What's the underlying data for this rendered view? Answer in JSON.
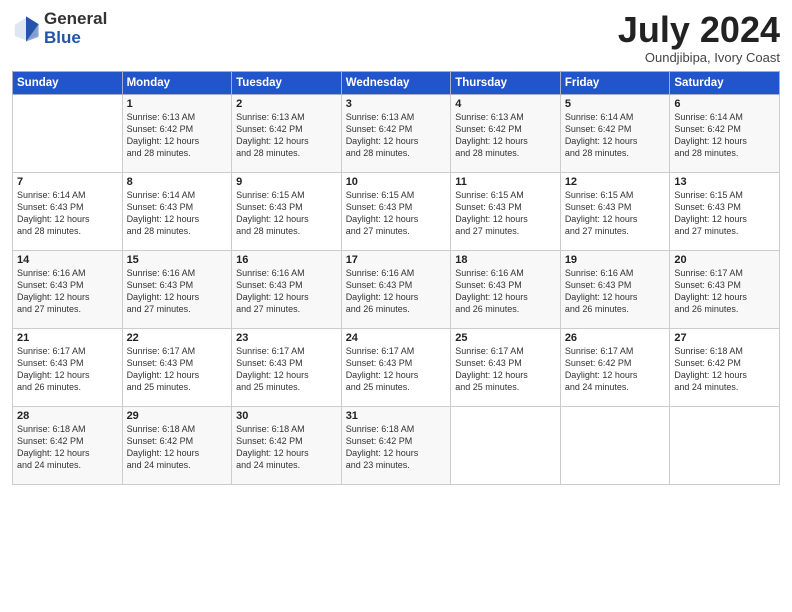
{
  "header": {
    "logo_general": "General",
    "logo_blue": "Blue",
    "month_title": "July 2024",
    "subtitle": "Oundjibipa, Ivory Coast"
  },
  "days_of_week": [
    "Sunday",
    "Monday",
    "Tuesday",
    "Wednesday",
    "Thursday",
    "Friday",
    "Saturday"
  ],
  "weeks": [
    [
      {
        "day": "",
        "info": ""
      },
      {
        "day": "1",
        "info": "Sunrise: 6:13 AM\nSunset: 6:42 PM\nDaylight: 12 hours\nand 28 minutes."
      },
      {
        "day": "2",
        "info": "Sunrise: 6:13 AM\nSunset: 6:42 PM\nDaylight: 12 hours\nand 28 minutes."
      },
      {
        "day": "3",
        "info": "Sunrise: 6:13 AM\nSunset: 6:42 PM\nDaylight: 12 hours\nand 28 minutes."
      },
      {
        "day": "4",
        "info": "Sunrise: 6:13 AM\nSunset: 6:42 PM\nDaylight: 12 hours\nand 28 minutes."
      },
      {
        "day": "5",
        "info": "Sunrise: 6:14 AM\nSunset: 6:42 PM\nDaylight: 12 hours\nand 28 minutes."
      },
      {
        "day": "6",
        "info": "Sunrise: 6:14 AM\nSunset: 6:42 PM\nDaylight: 12 hours\nand 28 minutes."
      }
    ],
    [
      {
        "day": "7",
        "info": "Sunrise: 6:14 AM\nSunset: 6:43 PM\nDaylight: 12 hours\nand 28 minutes."
      },
      {
        "day": "8",
        "info": "Sunrise: 6:14 AM\nSunset: 6:43 PM\nDaylight: 12 hours\nand 28 minutes."
      },
      {
        "day": "9",
        "info": "Sunrise: 6:15 AM\nSunset: 6:43 PM\nDaylight: 12 hours\nand 28 minutes."
      },
      {
        "day": "10",
        "info": "Sunrise: 6:15 AM\nSunset: 6:43 PM\nDaylight: 12 hours\nand 27 minutes."
      },
      {
        "day": "11",
        "info": "Sunrise: 6:15 AM\nSunset: 6:43 PM\nDaylight: 12 hours\nand 27 minutes."
      },
      {
        "day": "12",
        "info": "Sunrise: 6:15 AM\nSunset: 6:43 PM\nDaylight: 12 hours\nand 27 minutes."
      },
      {
        "day": "13",
        "info": "Sunrise: 6:15 AM\nSunset: 6:43 PM\nDaylight: 12 hours\nand 27 minutes."
      }
    ],
    [
      {
        "day": "14",
        "info": "Sunrise: 6:16 AM\nSunset: 6:43 PM\nDaylight: 12 hours\nand 27 minutes."
      },
      {
        "day": "15",
        "info": "Sunrise: 6:16 AM\nSunset: 6:43 PM\nDaylight: 12 hours\nand 27 minutes."
      },
      {
        "day": "16",
        "info": "Sunrise: 6:16 AM\nSunset: 6:43 PM\nDaylight: 12 hours\nand 27 minutes."
      },
      {
        "day": "17",
        "info": "Sunrise: 6:16 AM\nSunset: 6:43 PM\nDaylight: 12 hours\nand 26 minutes."
      },
      {
        "day": "18",
        "info": "Sunrise: 6:16 AM\nSunset: 6:43 PM\nDaylight: 12 hours\nand 26 minutes."
      },
      {
        "day": "19",
        "info": "Sunrise: 6:16 AM\nSunset: 6:43 PM\nDaylight: 12 hours\nand 26 minutes."
      },
      {
        "day": "20",
        "info": "Sunrise: 6:17 AM\nSunset: 6:43 PM\nDaylight: 12 hours\nand 26 minutes."
      }
    ],
    [
      {
        "day": "21",
        "info": "Sunrise: 6:17 AM\nSunset: 6:43 PM\nDaylight: 12 hours\nand 26 minutes."
      },
      {
        "day": "22",
        "info": "Sunrise: 6:17 AM\nSunset: 6:43 PM\nDaylight: 12 hours\nand 25 minutes."
      },
      {
        "day": "23",
        "info": "Sunrise: 6:17 AM\nSunset: 6:43 PM\nDaylight: 12 hours\nand 25 minutes."
      },
      {
        "day": "24",
        "info": "Sunrise: 6:17 AM\nSunset: 6:43 PM\nDaylight: 12 hours\nand 25 minutes."
      },
      {
        "day": "25",
        "info": "Sunrise: 6:17 AM\nSunset: 6:43 PM\nDaylight: 12 hours\nand 25 minutes."
      },
      {
        "day": "26",
        "info": "Sunrise: 6:17 AM\nSunset: 6:42 PM\nDaylight: 12 hours\nand 24 minutes."
      },
      {
        "day": "27",
        "info": "Sunrise: 6:18 AM\nSunset: 6:42 PM\nDaylight: 12 hours\nand 24 minutes."
      }
    ],
    [
      {
        "day": "28",
        "info": "Sunrise: 6:18 AM\nSunset: 6:42 PM\nDaylight: 12 hours\nand 24 minutes."
      },
      {
        "day": "29",
        "info": "Sunrise: 6:18 AM\nSunset: 6:42 PM\nDaylight: 12 hours\nand 24 minutes."
      },
      {
        "day": "30",
        "info": "Sunrise: 6:18 AM\nSunset: 6:42 PM\nDaylight: 12 hours\nand 24 minutes."
      },
      {
        "day": "31",
        "info": "Sunrise: 6:18 AM\nSunset: 6:42 PM\nDaylight: 12 hours\nand 23 minutes."
      },
      {
        "day": "",
        "info": ""
      },
      {
        "day": "",
        "info": ""
      },
      {
        "day": "",
        "info": ""
      }
    ]
  ]
}
